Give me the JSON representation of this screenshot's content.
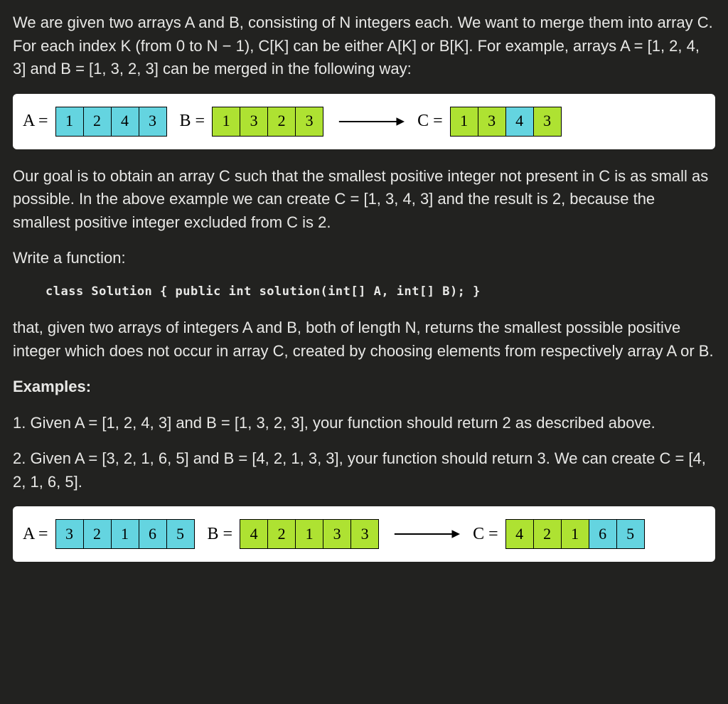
{
  "intro": "We are given two arrays A and B, consisting of N integers each. We want to merge them into array C. For each index K (from 0 to N − 1), C[K] can be either A[K] or B[K]. For example, arrays A = [1, 2, 4, 3] and B = [1, 3, 2, 3] can be merged in the following way:",
  "diagram1": {
    "A": {
      "label": "A =",
      "cells": [
        {
          "v": "1",
          "c": "cyan"
        },
        {
          "v": "2",
          "c": "cyan"
        },
        {
          "v": "4",
          "c": "cyan"
        },
        {
          "v": "3",
          "c": "cyan"
        }
      ]
    },
    "B": {
      "label": "B =",
      "cells": [
        {
          "v": "1",
          "c": "green"
        },
        {
          "v": "3",
          "c": "green"
        },
        {
          "v": "2",
          "c": "green"
        },
        {
          "v": "3",
          "c": "green"
        }
      ]
    },
    "C": {
      "label": "C =",
      "cells": [
        {
          "v": "1",
          "c": "green"
        },
        {
          "v": "3",
          "c": "green"
        },
        {
          "v": "4",
          "c": "cyan"
        },
        {
          "v": "3",
          "c": "green"
        }
      ]
    }
  },
  "goal": "Our goal is to obtain an array C such that the smallest positive integer not present in C is as small as possible. In the above example we can create C = [1, 3, 4, 3] and the result is 2, because the smallest positive integer excluded from C is 2.",
  "writeFunc": "Write a function:",
  "signature": "class Solution { public int solution(int[] A, int[] B); }",
  "task": "that, given two arrays of integers A and B, both of length N, returns the smallest possible positive integer which does not occur in array C, created by choosing elements from respectively array A or B.",
  "examplesHeading": "Examples:",
  "ex1": "1. Given A = [1, 2, 4, 3] and B = [1, 3, 2, 3], your function should return 2 as described above.",
  "ex2": "2. Given A = [3, 2, 1, 6, 5] and B = [4, 2, 1, 3, 3], your function should return 3. We can create C = [4, 2, 1, 6, 5].",
  "diagram2": {
    "A": {
      "label": "A =",
      "cells": [
        {
          "v": "3",
          "c": "cyan"
        },
        {
          "v": "2",
          "c": "cyan"
        },
        {
          "v": "1",
          "c": "cyan"
        },
        {
          "v": "6",
          "c": "cyan"
        },
        {
          "v": "5",
          "c": "cyan"
        }
      ]
    },
    "B": {
      "label": "B =",
      "cells": [
        {
          "v": "4",
          "c": "green"
        },
        {
          "v": "2",
          "c": "green"
        },
        {
          "v": "1",
          "c": "green"
        },
        {
          "v": "3",
          "c": "green"
        },
        {
          "v": "3",
          "c": "green"
        }
      ]
    },
    "C": {
      "label": "C =",
      "cells": [
        {
          "v": "4",
          "c": "green"
        },
        {
          "v": "2",
          "c": "green"
        },
        {
          "v": "1",
          "c": "green"
        },
        {
          "v": "6",
          "c": "cyan"
        },
        {
          "v": "5",
          "c": "cyan"
        }
      ]
    }
  }
}
